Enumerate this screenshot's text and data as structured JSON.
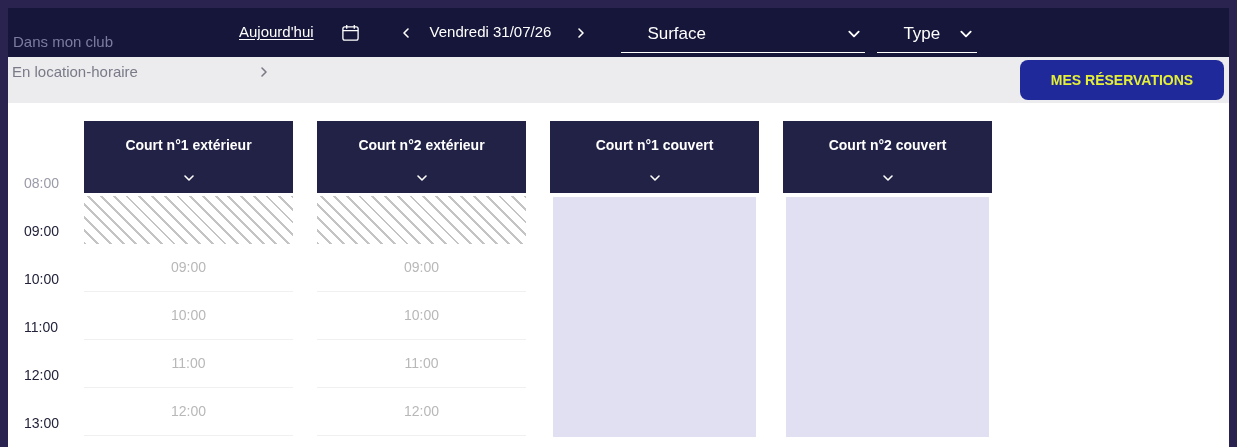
{
  "background_menu": {
    "items": [
      {
        "label": "Dans mon club"
      },
      {
        "label": "En location-horaire"
      }
    ]
  },
  "toolbar": {
    "today_link": "Aujourd'hui",
    "date": "Vendredi 31/07/26",
    "filters": [
      {
        "label": "Surface"
      },
      {
        "label": "Type"
      }
    ]
  },
  "reservations_button": "MES RÉSERVATIONS",
  "time_labels": [
    {
      "label": "08:00",
      "muted": true
    },
    {
      "label": "09:00",
      "muted": false
    },
    {
      "label": "10:00",
      "muted": false
    },
    {
      "label": "11:00",
      "muted": false
    },
    {
      "label": "12:00",
      "muted": false
    },
    {
      "label": "13:00",
      "muted": false
    }
  ],
  "courts": [
    {
      "name": "Court n°1 extérieur",
      "kind": "open",
      "slots": [
        "09:00",
        "10:00",
        "11:00",
        "12:00"
      ]
    },
    {
      "name": "Court n°2 extérieur",
      "kind": "open",
      "slots": [
        "09:00",
        "10:00",
        "11:00",
        "12:00"
      ]
    },
    {
      "name": "Court n°1 couvert",
      "kind": "blocked"
    },
    {
      "name": "Court n°2 couvert",
      "kind": "blocked"
    }
  ]
}
